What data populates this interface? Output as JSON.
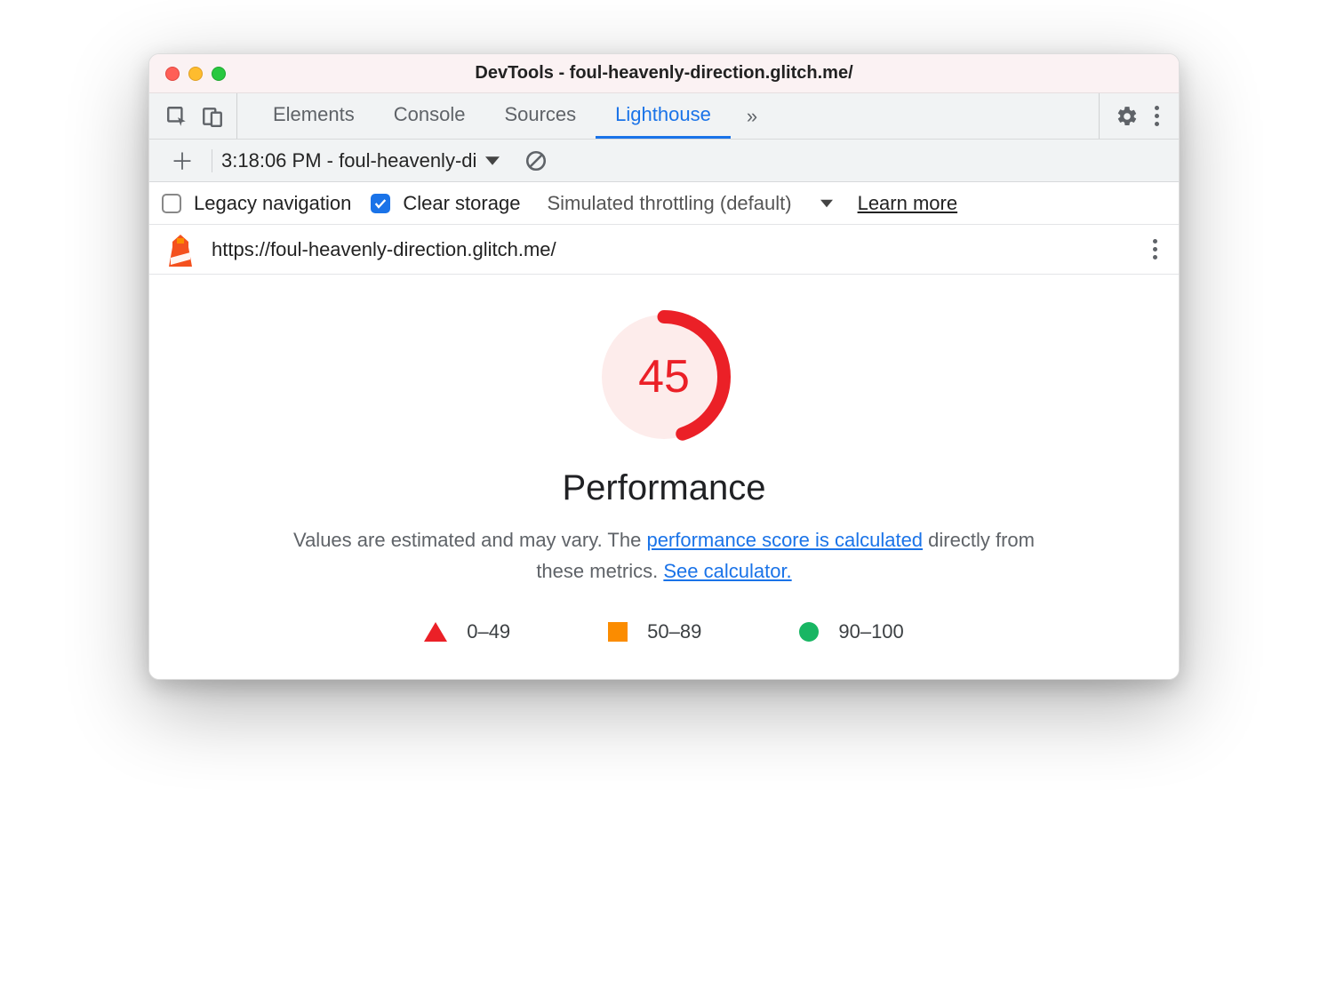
{
  "window": {
    "title": "DevTools - foul-heavenly-direction.glitch.me/"
  },
  "tabs": {
    "elements": "Elements",
    "console": "Console",
    "sources": "Sources",
    "lighthouse": "Lighthouse",
    "more_glyph": "»"
  },
  "subbar": {
    "report_label": "3:18:06 PM - foul-heavenly-di"
  },
  "options": {
    "legacy_label": "Legacy navigation",
    "clear_label": "Clear storage",
    "throttle_label": "Simulated throttling (default)",
    "learn_more": "Learn more"
  },
  "url": "https://foul-heavenly-direction.glitch.me/",
  "gauge": {
    "score": "45",
    "percent": 45
  },
  "perf": {
    "title": "Performance",
    "desc_pre": "Values are estimated and may vary. The ",
    "desc_link1": "performance score is calculated",
    "desc_mid": " directly from these metrics. ",
    "desc_link2": "See calculator."
  },
  "legend": {
    "r0": "0–49",
    "r1": "50–89",
    "r2": "90–100"
  }
}
